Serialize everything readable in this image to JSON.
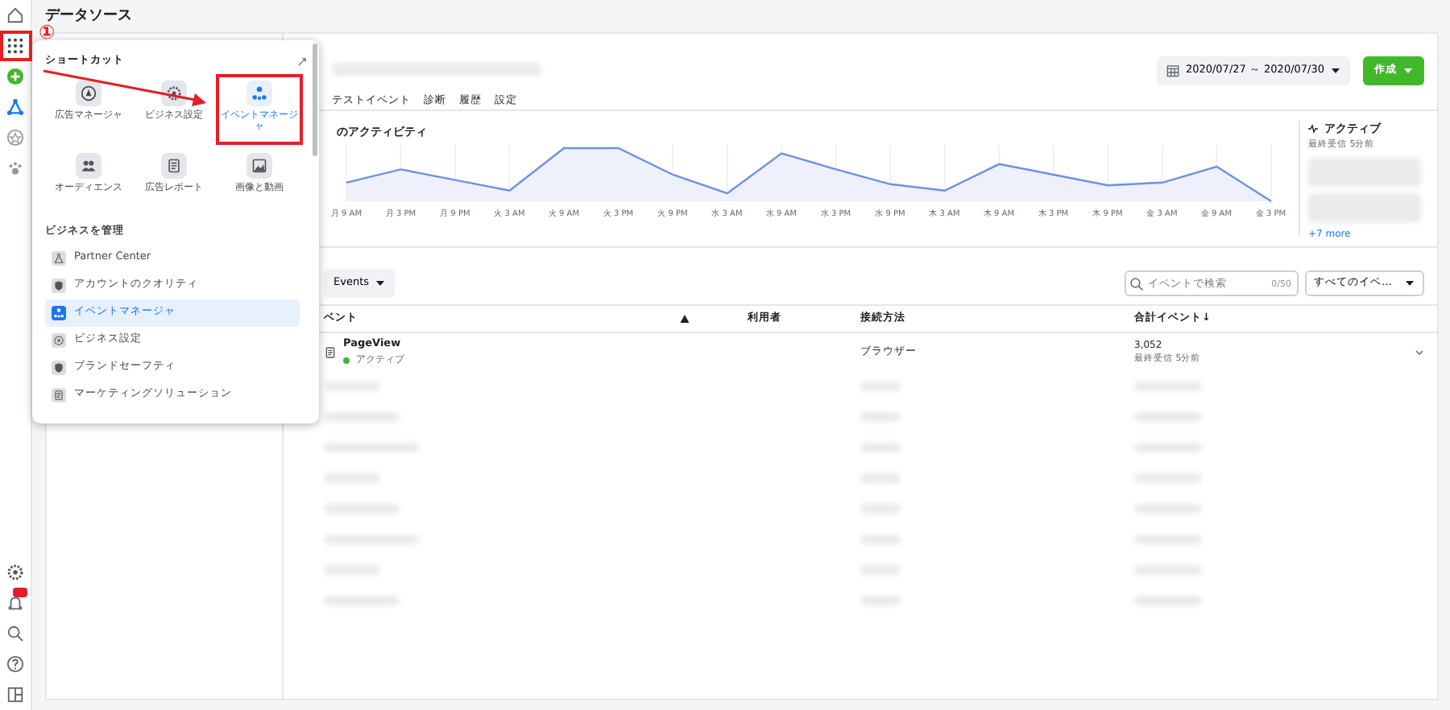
{
  "page_title": "データソース",
  "annotation": {
    "number": "①"
  },
  "shortcut_menu": {
    "heading": "ショートカット",
    "shortcuts": [
      {
        "label": "広告マネージャ",
        "selected": false
      },
      {
        "label": "ビジネス設定",
        "selected": false
      },
      {
        "label": "イベントマネージャ",
        "selected": true
      },
      {
        "label": "オーディエンス",
        "selected": false
      },
      {
        "label": "広告レポート",
        "selected": false
      },
      {
        "label": "画像と動画",
        "selected": false
      }
    ],
    "section_heading": "ビジネスを管理",
    "items": [
      {
        "label": "Partner Center",
        "selected": false
      },
      {
        "label": "アカウントのクオリティ",
        "selected": false
      },
      {
        "label": "イベントマネージャ",
        "selected": true
      },
      {
        "label": "ビジネス設定",
        "selected": false
      },
      {
        "label": "ブランドセーフティ",
        "selected": false
      },
      {
        "label": "マーケティングソリューション",
        "selected": false
      }
    ]
  },
  "tabs": [
    {
      "label": "テストイベント",
      "selected": false
    },
    {
      "label": "診断",
      "selected": false
    },
    {
      "label": "履歴",
      "selected": false
    },
    {
      "label": "設定",
      "selected": false
    }
  ],
  "date_range": "2020/07/27 ～ 2020/07/30",
  "create_button": "作成",
  "activity": {
    "title": "のアクティビティ",
    "x_labels": [
      "月 9 AM",
      "月 3 PM",
      "月 9 PM",
      "火 3 AM",
      "火 9 AM",
      "火 3 PM",
      "火 9 PM",
      "水 3 AM",
      "水 9 AM",
      "水 3 PM",
      "水 9 PM",
      "木 3 AM",
      "木 9 AM",
      "木 3 PM",
      "木 9 PM",
      "金 3 AM",
      "金 9 AM",
      "金 3 PM"
    ]
  },
  "status_panel": {
    "label": "アクティブ",
    "last_received": "最終受信 5分前",
    "more_link": "+7 more"
  },
  "filter": "Events",
  "search": {
    "placeholder": "イベントで検索",
    "count": "0/50"
  },
  "event_dropdown": "すべてのイベ…",
  "table": {
    "columns": [
      "ベント",
      "利用者",
      "接続方法",
      "合計イベント↓"
    ],
    "rows": [
      {
        "name": "PageView",
        "status": "アクティブ",
        "active": true,
        "connection": "ブラウザー",
        "total": "3,052",
        "last_received": "最終受信 5分前"
      }
    ]
  }
}
